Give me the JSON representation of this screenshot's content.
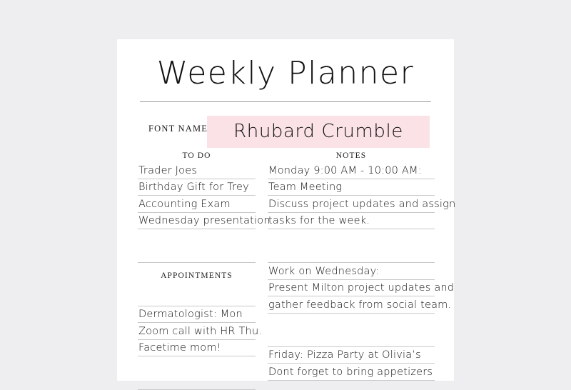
{
  "page": {
    "title": "Weekly Planner",
    "background_color": "#ffffff",
    "canvas_color": "#eeeef1",
    "accent_color": "#fbe2e6"
  },
  "font_name_field": {
    "label": "FONT NAME:",
    "value": "Rhubard Crumble"
  },
  "todo": {
    "heading": "TO DO",
    "items": [
      "Trader Joes",
      "Birthday Gift for Trey",
      "Accounting Exam",
      "Wednesday presentation"
    ]
  },
  "appointments": {
    "heading": "APPOINTMENTS",
    "items": [
      "Dermatologist: Mon",
      "Zoom call with HR Thu.",
      "Facetime mom!"
    ]
  },
  "notes": {
    "heading": "NOTES",
    "blocks": [
      {
        "lines": [
          "Monday 9:00 AM - 10:00 AM:",
          "Team Meeting",
          "Discuss project updates and assign",
          "tasks for the week."
        ]
      },
      {
        "lines": [
          "Work on Wednesday:",
          "Present Milton project updates and",
          "gather feedback from social team."
        ]
      },
      {
        "lines": [
          "Friday: Pizza Party at Olivia’s",
          "Dont forget to bring appetizers"
        ]
      }
    ]
  }
}
